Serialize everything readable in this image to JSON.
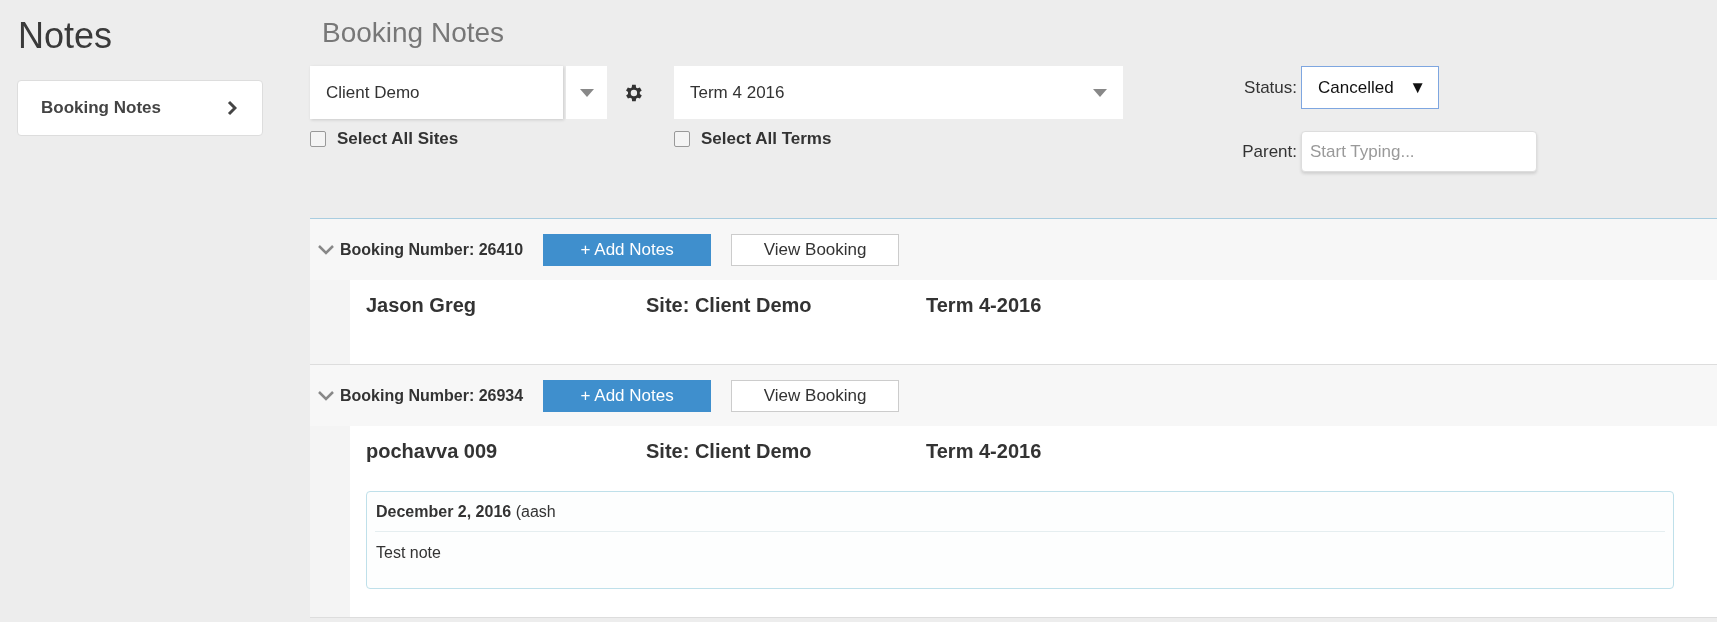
{
  "sidebar": {
    "title": "Notes",
    "items": [
      {
        "label": "Booking Notes"
      }
    ]
  },
  "main": {
    "title": "Booking Notes",
    "site_select": {
      "value": "Client Demo"
    },
    "select_all_sites": {
      "label": "Select All Sites",
      "checked": false
    },
    "term_select": {
      "value": "Term 4 2016"
    },
    "select_all_terms": {
      "label": "Select All Terms",
      "checked": false
    },
    "status": {
      "label": "Status:",
      "value": "Cancelled",
      "arrow": "▼"
    },
    "parent": {
      "label": "Parent:",
      "placeholder": "Start Typing..."
    }
  },
  "bookings": [
    {
      "number": "Booking Number: 26410",
      "expanded": true,
      "add_button": "+ Add Notes",
      "view_button": "View Booking",
      "name": "Jason Greg",
      "site": "Site: Client Demo",
      "term": "Term 4-2016"
    },
    {
      "number": "Booking Number: 26934",
      "expanded": true,
      "add_button": "+ Add Notes",
      "view_button": "View Booking",
      "name": "pochavva 009",
      "site": "Site: Client Demo",
      "term": "Term 4-2016",
      "notes": [
        {
          "header": "**December 2, 2016** (aash",
          "text": "Test note"
        }
      ]
    }
  ]
}
